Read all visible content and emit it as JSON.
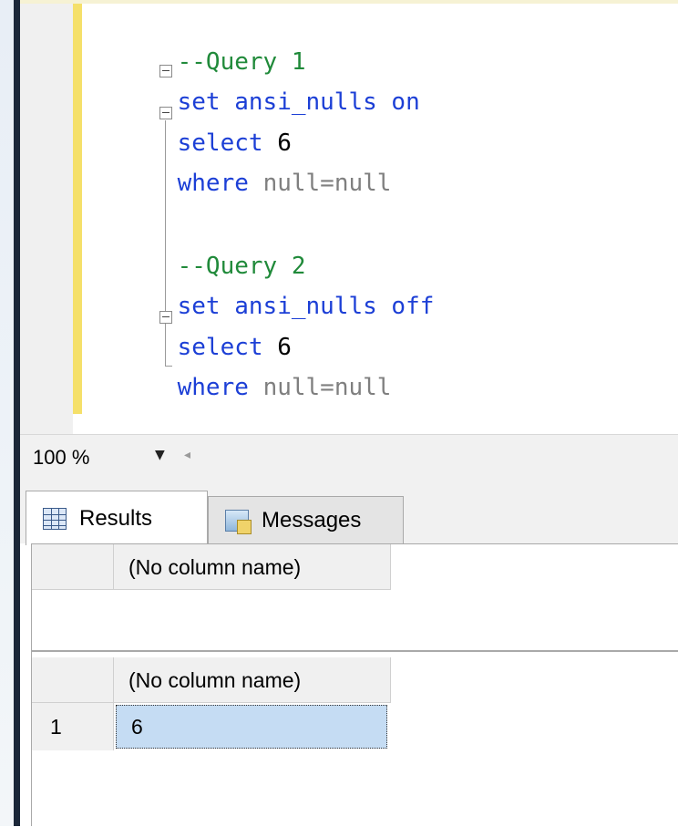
{
  "editor": {
    "lines": [
      {
        "type": "comment",
        "text": "--Query 1"
      },
      {
        "type": "statement",
        "keyword": "set ansi_nulls on"
      },
      {
        "type": "select",
        "keyword": "select",
        "value": "6"
      },
      {
        "type": "where",
        "keyword": "where",
        "rest": "null=null"
      },
      {
        "type": "comment",
        "text": "--Query 2"
      },
      {
        "type": "statement",
        "keyword": "set ansi_nulls off"
      },
      {
        "type": "select",
        "keyword": "select",
        "value": "6"
      },
      {
        "type": "where",
        "keyword": "where",
        "rest": "null=null"
      }
    ],
    "colors": {
      "keyword": "#1c3fd6",
      "comment": "#208a3a",
      "change_bar": "#f5e06a"
    }
  },
  "zoom": {
    "value": "100 %",
    "dropdown_icon": "caret-down-icon",
    "scroll_icon": "scroll-left-icon"
  },
  "tabs": [
    {
      "label": "Results",
      "icon": "grid-icon",
      "active": true
    },
    {
      "label": "Messages",
      "icon": "messages-icon",
      "active": false
    }
  ],
  "results": {
    "grids": [
      {
        "columns": [
          "(No column name)"
        ],
        "rows": []
      },
      {
        "columns": [
          "(No column name)"
        ],
        "rows": [
          {
            "num": "1",
            "values": [
              "6"
            ]
          }
        ]
      }
    ],
    "selection_color": "#c5dcf3"
  }
}
